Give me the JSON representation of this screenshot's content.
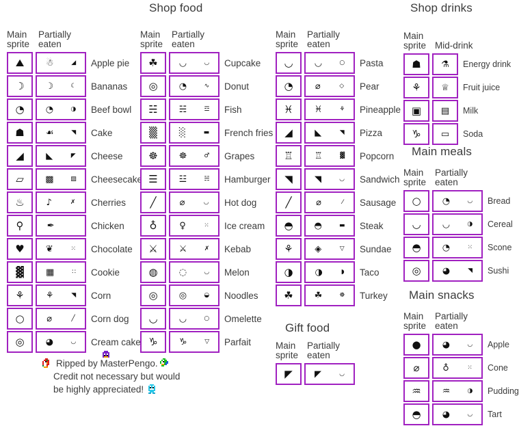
{
  "colors": {
    "box_border": "#A020C0",
    "text": "#3b3b3b",
    "background": "#ffffff",
    "sprite_ink": "#111111"
  },
  "headers": {
    "main_sprite": "Main\nsprite",
    "partially_eaten": "Partially\neaten",
    "mid_drink": "Mid-drink"
  },
  "sections": {
    "shop_food": {
      "title": "Shop food",
      "columns": [
        {
          "header_main": "Main\nsprite",
          "header_partial": "Partially\neaten",
          "items": [
            {
              "label": "Apple pie",
              "main": "⛰",
              "p1": "☃",
              "p2": "◢"
            },
            {
              "label": "Bananas",
              "main": "☽",
              "p1": "☽",
              "p2": "☾"
            },
            {
              "label": "Beef bowl",
              "main": "◔",
              "p1": "◔",
              "p2": "◑"
            },
            {
              "label": "Cake",
              "main": "☗",
              "p1": "☙",
              "p2": "◥"
            },
            {
              "label": "Cheese",
              "main": "◢",
              "p1": "◣",
              "p2": "◤"
            },
            {
              "label": "Cheesecake",
              "main": "▱",
              "p1": "▩",
              "p2": "▨"
            },
            {
              "label": "Cherries",
              "main": "♨",
              "p1": "♪",
              "p2": "✗"
            },
            {
              "label": "Chicken",
              "main": "⚲",
              "p1": "✒",
              "p2": ""
            },
            {
              "label": "Chocolate",
              "main": "♥",
              "p1": "❦",
              "p2": "⁙"
            },
            {
              "label": "Cookie",
              "main": "▓",
              "p1": "▦",
              "p2": "∷"
            },
            {
              "label": "Corn",
              "main": "⚘",
              "p1": "⚘",
              "p2": "◥"
            },
            {
              "label": "Corn dog",
              "main": "○",
              "p1": "⌀",
              "p2": "╱"
            },
            {
              "label": "Cream cake",
              "main": "◎",
              "p1": "◕",
              "p2": "◡"
            }
          ]
        },
        {
          "header_main": "Main\nsprite",
          "header_partial": "Partially\neaten",
          "items": [
            {
              "label": "Cupcake",
              "main": "☘",
              "p1": "◡",
              "p2": "◡"
            },
            {
              "label": "Donut",
              "main": "◎",
              "p1": "◔",
              "p2": "∿"
            },
            {
              "label": "Fish",
              "main": "☵",
              "p1": "☵",
              "p2": "☲"
            },
            {
              "label": "French fries",
              "main": "▒",
              "p1": "░",
              "p2": "▬"
            },
            {
              "label": "Grapes",
              "main": "☸",
              "p1": "☸",
              "p2": "♂"
            },
            {
              "label": "Hamburger",
              "main": "☰",
              "p1": "☳",
              "p2": "☵"
            },
            {
              "label": "Hot dog",
              "main": "╱",
              "p1": "⌀",
              "p2": "◡"
            },
            {
              "label": "Ice cream",
              "main": "♁",
              "p1": "♀",
              "p2": "⁙"
            },
            {
              "label": "Kebab",
              "main": "⚔",
              "p1": "⚔",
              "p2": "✗"
            },
            {
              "label": "Melon",
              "main": "◍",
              "p1": "◌",
              "p2": "◡"
            },
            {
              "label": "Noodles",
              "main": "◎",
              "p1": "◎",
              "p2": "◒"
            },
            {
              "label": "Omelette",
              "main": "◡",
              "p1": "◡",
              "p2": "○"
            },
            {
              "label": "Parfait",
              "main": "♑",
              "p1": "♑",
              "p2": "▽"
            }
          ]
        },
        {
          "header_main": "Main\nsprite",
          "header_partial": "Partially\neaten",
          "items": [
            {
              "label": "Pasta",
              "main": "◡",
              "p1": "◡",
              "p2": "○"
            },
            {
              "label": "Pear",
              "main": "◔",
              "p1": "⌀",
              "p2": "◇"
            },
            {
              "label": "Pineapple",
              "main": "♓",
              "p1": "♓",
              "p2": "⚘"
            },
            {
              "label": "Pizza",
              "main": "◢",
              "p1": "◣",
              "p2": "◥"
            },
            {
              "label": "Popcorn",
              "main": "♖",
              "p1": "♖",
              "p2": "▓"
            },
            {
              "label": "Sandwich",
              "main": "◥",
              "p1": "◥",
              "p2": "◡"
            },
            {
              "label": "Sausage",
              "main": "╱",
              "p1": "⌀",
              "p2": "⁄"
            },
            {
              "label": "Steak",
              "main": "◓",
              "p1": "◓",
              "p2": "▬"
            },
            {
              "label": "Sundae",
              "main": "⚘",
              "p1": "◈",
              "p2": "▽"
            },
            {
              "label": "Taco",
              "main": "◑",
              "p1": "◑",
              "p2": "◗"
            },
            {
              "label": "Turkey",
              "main": "☘",
              "p1": "☘",
              "p2": "☸"
            }
          ]
        }
      ]
    },
    "shop_drinks": {
      "title": "Shop drinks",
      "header_main": "Main\nsprite",
      "header_partial": "Mid-drink",
      "items": [
        {
          "label": "Energy drink",
          "main": "☗",
          "p1": "⚗"
        },
        {
          "label": "Fruit juice",
          "main": "⚘",
          "p1": "♕"
        },
        {
          "label": "Milk",
          "main": "▣",
          "p1": "▤"
        },
        {
          "label": "Soda",
          "main": "♑",
          "p1": "▭"
        }
      ]
    },
    "main_meals": {
      "title": "Main meals",
      "header_main": "Main\nsprite",
      "header_partial": "Partially\neaten",
      "items": [
        {
          "label": "Bread",
          "main": "○",
          "p1": "◔",
          "p2": "◡"
        },
        {
          "label": "Cereal",
          "main": "◡",
          "p1": "◡",
          "p2": "◑"
        },
        {
          "label": "Scone",
          "main": "◓",
          "p1": "◔",
          "p2": "⁙"
        },
        {
          "label": "Sushi",
          "main": "◎",
          "p1": "◕",
          "p2": "◥"
        }
      ]
    },
    "main_snacks": {
      "title": "Main snacks",
      "header_main": "Main\nsprite",
      "header_partial": "Partially\neaten",
      "items": [
        {
          "label": "Apple",
          "main": "●",
          "p1": "◕",
          "p2": "◡"
        },
        {
          "label": "Cone",
          "main": "⌀",
          "p1": "♁",
          "p2": "⁙"
        },
        {
          "label": "Pudding",
          "main": "♒",
          "p1": "♒",
          "p2": "◑"
        },
        {
          "label": "Tart",
          "main": "◓",
          "p1": "◕",
          "p2": "◡"
        }
      ]
    },
    "gift_food": {
      "title": "Gift food",
      "header_main": "Main\nsprite",
      "header_partial": "Partially\neaten",
      "items": [
        {
          "label": "",
          "main": "◤",
          "p1": "◤",
          "p2": "◡"
        }
      ]
    }
  },
  "credit": {
    "line1": "Ripped by MasterPengo.",
    "line2": "Credit not necessary but would",
    "line3": "be highly appreciated!",
    "penguins": [
      "red-penguin",
      "purple-penguin",
      "green-penguin",
      "cyan-penguin"
    ]
  }
}
